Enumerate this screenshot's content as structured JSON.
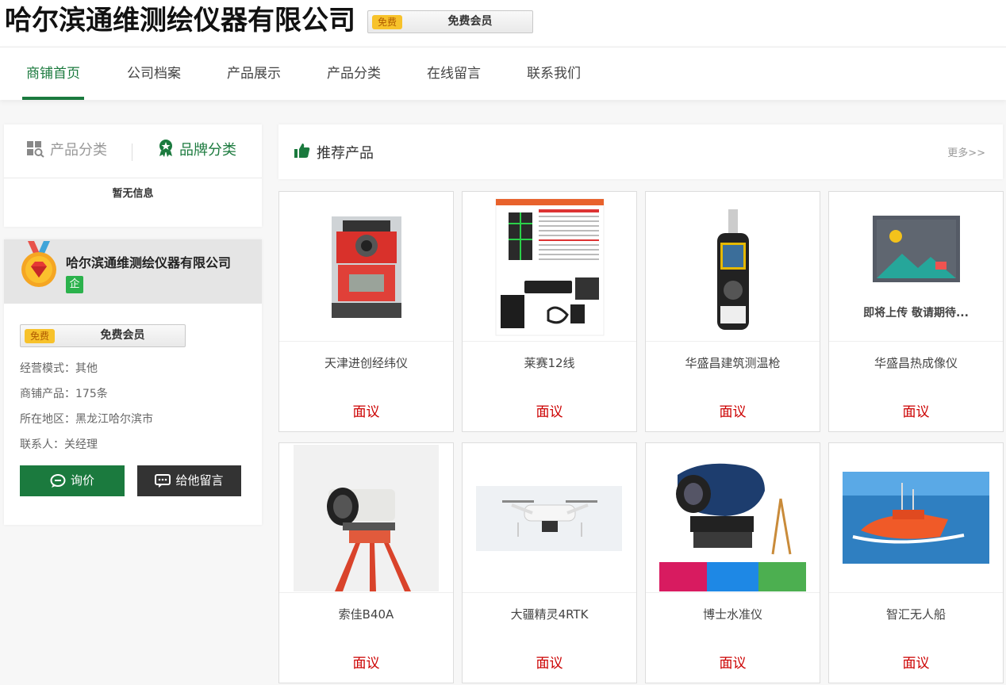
{
  "header": {
    "company_name": "哈尔滨通维测绘仪器有限公司",
    "member_tag": "免费",
    "member_label": "免费会员"
  },
  "nav": {
    "items": [
      "商铺首页",
      "公司档案",
      "产品展示",
      "产品分类",
      "在线留言",
      "联系我们"
    ],
    "active_index": 0
  },
  "sidebar": {
    "tabs": [
      "产品分类",
      "品牌分类"
    ],
    "active_tab": 1,
    "empty_text": "暂无信息",
    "company_name": "哈尔滨通维测绘仪器有限公司",
    "qi_label": "企",
    "member_tag": "免费",
    "member_label": "免费会员",
    "info": [
      {
        "label": "经营模式：",
        "value": "其他"
      },
      {
        "label": "商铺产品：",
        "value": "175条"
      },
      {
        "label": "所在地区：",
        "value": "黑龙江哈尔滨市"
      },
      {
        "label": "联系人：",
        "value": "关经理"
      }
    ],
    "ask_button": "询价",
    "message_button": "给他留言"
  },
  "recommend": {
    "title": "推荐产品",
    "more": "更多>>",
    "placeholder_text": "即将上传  敬请期待...",
    "products": [
      {
        "name": "天津进创经纬仪",
        "price": "面议",
        "image": "total-station"
      },
      {
        "name": "莱赛12线",
        "price": "面议",
        "image": "laser-level-spec"
      },
      {
        "name": "华盛昌建筑测温枪",
        "price": "面议",
        "image": "handheld-meter"
      },
      {
        "name": "华盛昌热成像仪",
        "price": "面议",
        "image": "placeholder"
      },
      {
        "name": "索佳B40A",
        "price": "面议",
        "image": "auto-level-tripod"
      },
      {
        "name": "大疆精灵4RTK",
        "price": "面议",
        "image": "drone"
      },
      {
        "name": "博士水准仪",
        "price": "面议",
        "image": "level-kit"
      },
      {
        "name": "智汇无人船",
        "price": "面议",
        "image": "unmanned-boat"
      }
    ]
  },
  "colors": {
    "brand_green": "#1b7a3e",
    "price_red": "#cc0000",
    "member_gold": "#f7c22b"
  }
}
